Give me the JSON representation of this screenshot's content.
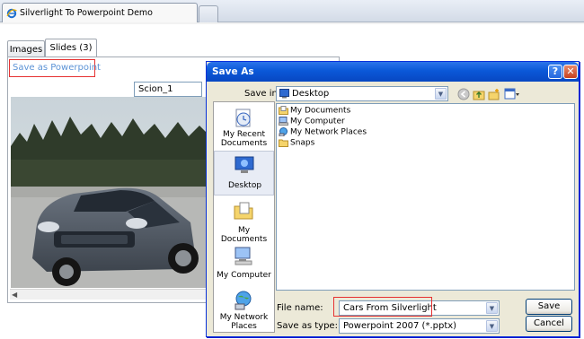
{
  "browser": {
    "tab_title": "Silverlight To Powerpoint Demo"
  },
  "app": {
    "tabs": [
      {
        "label": "Images"
      },
      {
        "label": "Slides (3)"
      }
    ],
    "save_link": "Save as Powerpoint",
    "slide_name": "Scion_1"
  },
  "dialog": {
    "title": "Save As",
    "help_label": "?",
    "close_label": "✕",
    "save_in_label": "Save in:",
    "save_in_value": "Desktop",
    "places": [
      {
        "label": "My Recent Documents"
      },
      {
        "label": "Desktop"
      },
      {
        "label": "My Documents"
      },
      {
        "label": "My Computer"
      },
      {
        "label": "My Network Places"
      }
    ],
    "files": [
      {
        "name": "My Documents"
      },
      {
        "name": "My Computer"
      },
      {
        "name": "My Network Places"
      },
      {
        "name": "Snaps"
      }
    ],
    "file_name_label": "File name:",
    "file_name_value": "Cars From Silverlight",
    "save_type_label": "Save as type:",
    "save_type_value": "Powerpoint 2007 (*.pptx)",
    "save_button": "Save",
    "cancel_button": "Cancel"
  },
  "colors": {
    "dialog_titlebar": "#0a58d8",
    "dialog_body": "#ece9d8",
    "link": "#5c93d6",
    "highlight": "#e63131"
  }
}
